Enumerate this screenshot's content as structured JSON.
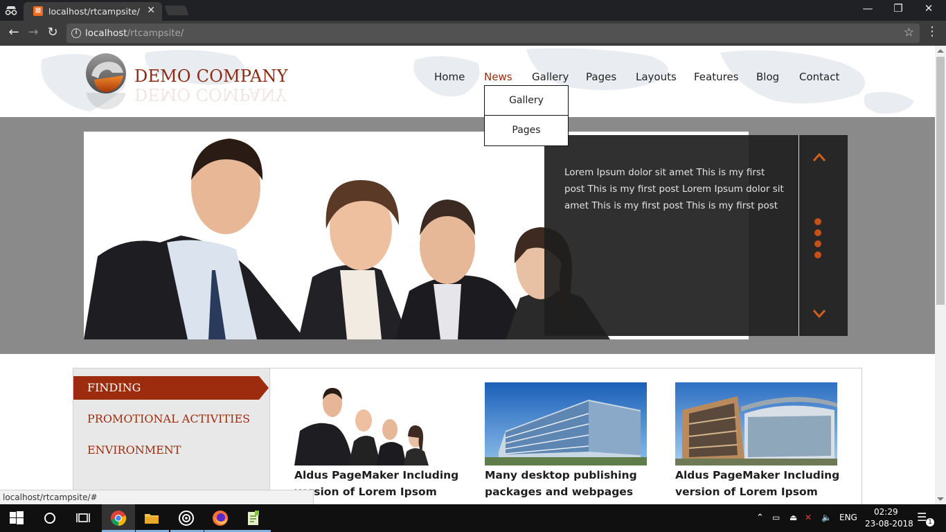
{
  "browser": {
    "tab_title": "localhost/rtcampsite/",
    "tab_close": "✕",
    "url_host": "localhost",
    "url_path": "/rtcampsite/",
    "window_controls": [
      "—",
      "❐",
      "✕"
    ],
    "status_url": "localhost/rtcampsite/#"
  },
  "site": {
    "brand": "DEMO COMPANY",
    "nav": [
      {
        "label": "Home"
      },
      {
        "label": "News"
      },
      {
        "label": "Gallery"
      },
      {
        "label": "Pages"
      },
      {
        "label": "Layouts"
      },
      {
        "label": "Features"
      },
      {
        "label": "Blog"
      },
      {
        "label": "Contact"
      }
    ],
    "active_nav": "News",
    "dropdown": [
      "Gallery",
      "Pages"
    ],
    "slider_text": "Lorem Ipsum dolor sit amet This is my first post This is my first post Lorem Ipsum dolor sit amet This is my first post This is my first post",
    "slider_dots": 4,
    "sidebar": [
      "FINDING",
      "PROMOTIONAL ACTIVITIES",
      "ENVIRONMENT"
    ],
    "cards": [
      {
        "title": "Aldus PageMaker Including version of Lorem Ipsom"
      },
      {
        "title": "Many desktop publishing packages and webpages"
      },
      {
        "title": "Aldus PageMaker Including version of Lorem Ipsom"
      }
    ]
  },
  "taskbar": {
    "language": "ENG",
    "time": "02:29",
    "date": "23-08-2018",
    "notification_count": "1"
  },
  "colors": {
    "accent": "#9d2c0e",
    "slider_dot": "#c5501a",
    "band": "#8a8a8a"
  }
}
